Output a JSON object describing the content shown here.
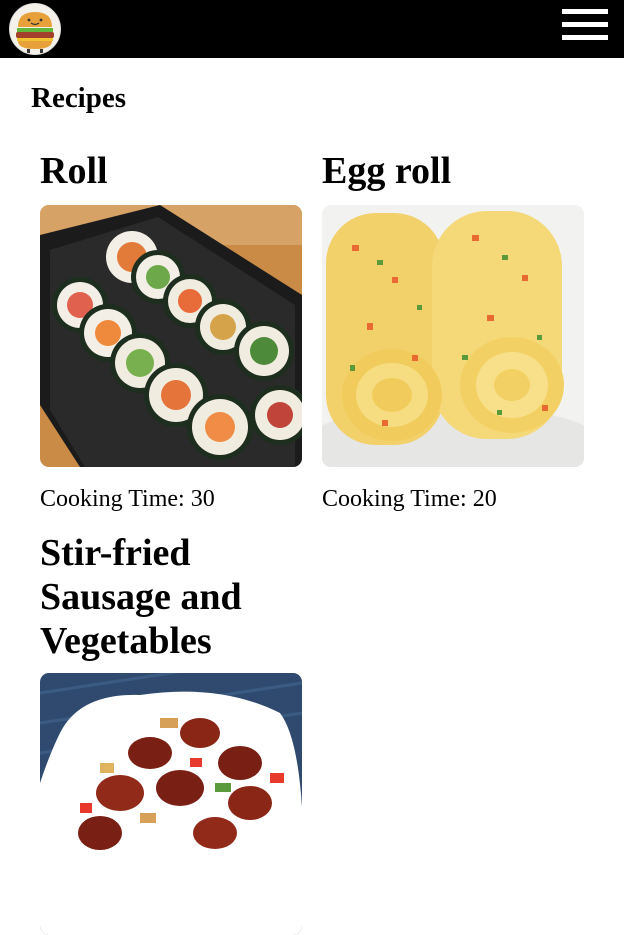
{
  "header": {
    "logo_icon": "burger-logo-icon",
    "menu_icon": "hamburger-menu-icon",
    "background": "#000000"
  },
  "page": {
    "title": "Recipes"
  },
  "recipes": [
    {
      "name": "Roll",
      "cooking_time": "Cooking Time: 30",
      "image_icon": "kimbap-photo"
    },
    {
      "name": "Egg roll",
      "cooking_time": "Cooking Time: 20",
      "image_icon": "egg-roll-photo"
    },
    {
      "name": "Stir-fried Sausage and Vegetables",
      "image_icon": "sausage-stirfry-photo"
    }
  ]
}
